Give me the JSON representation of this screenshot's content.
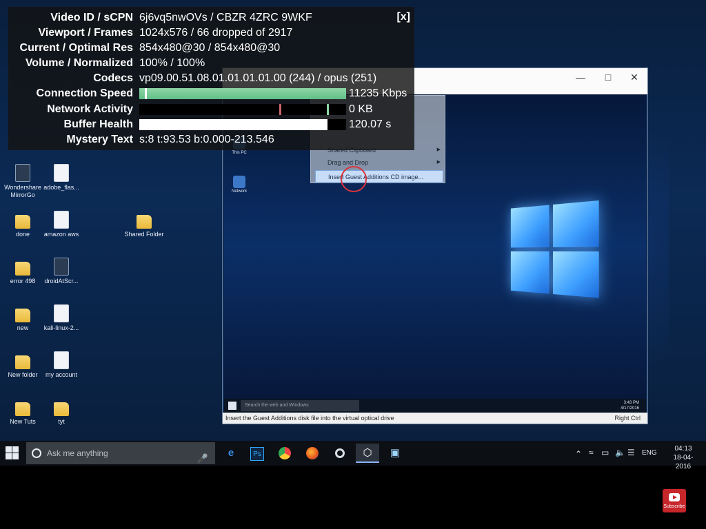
{
  "stats": {
    "rows": [
      {
        "label": "Video ID / sCPN",
        "value": "6j6vq5nwOVs / CBZR 4ZRC 9WKF"
      },
      {
        "label": "Viewport / Frames",
        "value": "1024x576 / 66 dropped of 2917"
      },
      {
        "label": "Current / Optimal Res",
        "value": "854x480@30 / 854x480@30"
      },
      {
        "label": "Volume / Normalized",
        "value": "100% / 100%"
      },
      {
        "label": "Codecs",
        "value": "vp09.00.51.08.01.01.01.01.00 (244) / opus (251)"
      },
      {
        "label": "Connection Speed",
        "value": "11235 Kbps",
        "fill": 1.0
      },
      {
        "label": "Network Activity",
        "value": "0 KB",
        "fill": 0.0
      },
      {
        "label": "Buffer Health",
        "value": "120.07 s",
        "fill": 0.91
      },
      {
        "label": "Mystery Text",
        "value": "s:8 t:93.53 b:0.000-213.546"
      }
    ],
    "close_label": "[x]"
  },
  "desktop": {
    "icons": [
      {
        "label": "Wondershare MirrorGo",
        "kind": "app"
      },
      {
        "label": "adobe_flas...",
        "kind": "file"
      },
      {
        "label": "done",
        "kind": "folder"
      },
      {
        "label": "amazon aws",
        "kind": "file"
      },
      {
        "label": "Shared Folder",
        "kind": "folder"
      },
      {
        "label": "error 498",
        "kind": "folder"
      },
      {
        "label": "droidAtScr...",
        "kind": "app"
      },
      {
        "label": "new",
        "kind": "folder"
      },
      {
        "label": "kali-linux-2...",
        "kind": "file"
      },
      {
        "label": "New folder",
        "kind": "folder"
      },
      {
        "label": "my account",
        "kind": "file"
      },
      {
        "label": "New Tuts",
        "kind": "folder"
      },
      {
        "label": "tyt",
        "kind": "folder"
      }
    ]
  },
  "vm": {
    "desktop_icons": [
      "This PC",
      "Network"
    ],
    "menu": {
      "items": [
        "Shared Clipboard",
        "Drag and Drop",
        "Insert Guest Additions CD image..."
      ]
    },
    "taskbar_search": "Search the web and Windows",
    "clock_time": "3:43 PM",
    "clock_date": "4/17/2016",
    "status_text": "Insert the Guest Additions disk file into the virtual optical drive",
    "right_ctrl": "Right Ctrl"
  },
  "taskbar": {
    "search_placeholder": "Ask me anything",
    "lang": "ENG",
    "time": "04:13",
    "date": "18-04-2016"
  },
  "subscribe_label": "Subscribe",
  "colors": {
    "bar_green": "#5fbf86",
    "subscribe_red": "#c7262b",
    "menu_highlight": "#c6dcf7"
  }
}
